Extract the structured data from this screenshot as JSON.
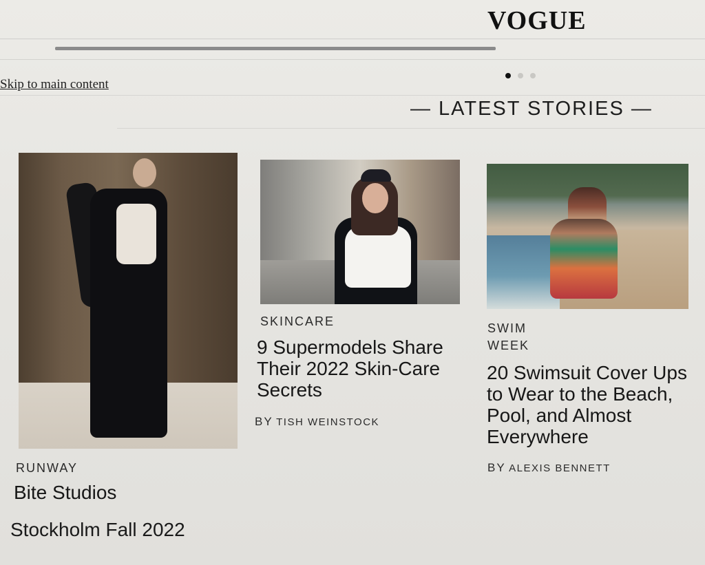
{
  "site": {
    "brand": "VOGUE",
    "skip_link": "Skip to main content",
    "section_heading": "— LATEST STORIES —"
  },
  "carousel": {
    "dots": 3,
    "active_index": 0
  },
  "stories": [
    {
      "id": "runway",
      "category": "RUNWAY",
      "headline": "Bite Studios",
      "subtitle": "Stockholm Fall 2022",
      "byline_prefix": "",
      "author": ""
    },
    {
      "id": "skincare",
      "category": "SKINCARE",
      "headline": "9 Supermodels Share Their 2022 Skin-Care Secrets",
      "byline_prefix": "BY",
      "author": "TISH WEINSTOCK"
    },
    {
      "id": "swim",
      "category": "SWIM WEEK",
      "headline": "20 Swimsuit Cover Ups to Wear to the Beach, Pool, and Almost Everywhere",
      "byline_prefix": "BY",
      "author": "ALEXIS BENNETT"
    }
  ],
  "colors": {
    "background": "#e6e5e1",
    "text": "#1b1b1b",
    "muted_rule": "#d3d2cf",
    "progress": "#8b8b8b",
    "active_dot": "#111111",
    "inactive_dot": "#c9c8c4"
  }
}
